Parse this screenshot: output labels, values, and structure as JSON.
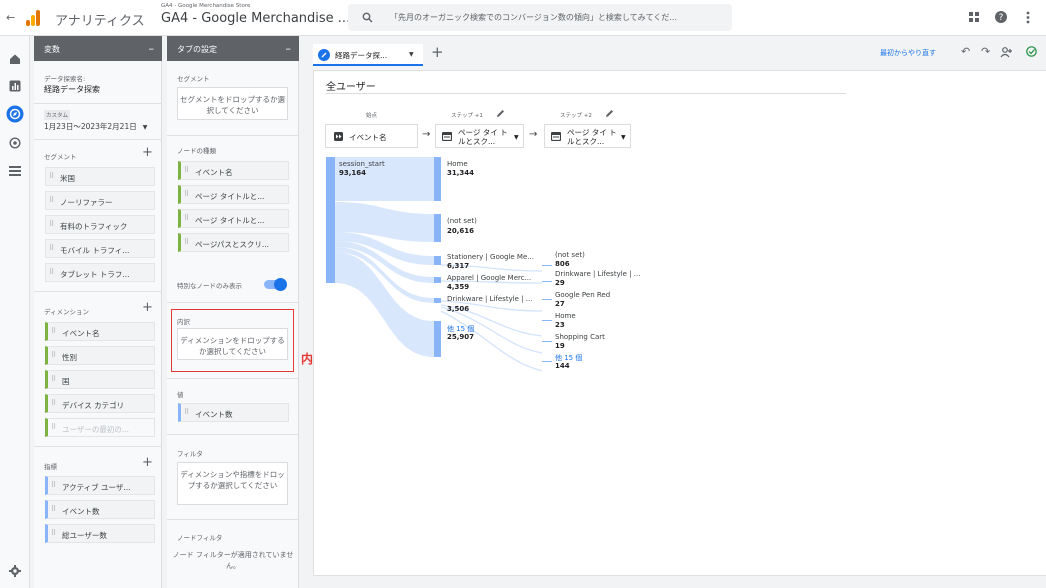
{
  "header": {
    "back": "←",
    "app_name": "アナリティクス",
    "account_path": "GA4 - Google Merchandise Store",
    "property": "GA4 - Google Merchandise ...",
    "search_placeholder": "「先月のオーガニック検索でのコンバージョン数の傾向」と検索してみてくだ..."
  },
  "variables": {
    "title": "変数",
    "name_label": "データ探索名:",
    "name_value": "経路データ探索",
    "custom_label": "カスタム",
    "date_range": "1月23日〜2023年2月21日",
    "segments_title": "セグメント",
    "segments": [
      "米国",
      "ノーリファラー",
      "有料のトラフィック",
      "モバイル トラフィ...",
      "タブレット トラフ..."
    ],
    "dimensions_title": "ディメンション",
    "dimensions": [
      "イベント名",
      "性別",
      "国",
      "デバイス カテゴリ",
      "ユーザーの最初の..."
    ],
    "metrics_title": "指標",
    "metrics": [
      "アクティブ ユーザ...",
      "イベント数",
      "総ユーザー数"
    ]
  },
  "settings": {
    "title": "タブの設定",
    "segment_label": "セグメント",
    "segment_drop": "セグメントをドロップするか選択してください",
    "node_type_label": "ノードの種類",
    "node_types": [
      "イベント名",
      "ページ タイトルと...",
      "ページ タイトルと...",
      "ページパスとスクリ..."
    ],
    "unique_nodes": "特別なノードのみ表示",
    "breakdown_label": "内訳",
    "breakdown_drop": "ディメンションをドロップするか選択してください",
    "value_label": "値",
    "value_chip": "イベント数",
    "filter_label": "フィルタ",
    "filter_drop": "ディメンションや指標をドロップするか選択してください",
    "node_filter_label": "ノードフィルタ",
    "node_filter_text": "ノード フィルターが適用されていません。"
  },
  "annotation": "内訳設定可能",
  "tab": {
    "name": "経路データ探...",
    "reset": "最初からやり直す"
  },
  "canvas": {
    "segment_title": "全ユーザー",
    "start_label": "始点",
    "start_select": "イベント名",
    "step1_label": "ステップ +1",
    "step1_select": "ページ タイ トルとスク...",
    "step2_label": "ステップ +2",
    "step2_select": "ページ タイ トルとスク..."
  },
  "chart_data": {
    "type": "sankey",
    "start": {
      "label": "session_start",
      "value": "93,164"
    },
    "step1": [
      {
        "label": "Home",
        "value": "31,344"
      },
      {
        "label": "(not set)",
        "value": "20,616"
      },
      {
        "label": "Stationery | Google Me...",
        "value": "6,317"
      },
      {
        "label": "Apparel | Google Merc...",
        "value": "4,359"
      },
      {
        "label": "Drinkware | Lifestyle | ...",
        "value": "3,506"
      },
      {
        "label": "他 15 個",
        "value": "25,907"
      }
    ],
    "step2": [
      {
        "label": "(not set)",
        "value": "806"
      },
      {
        "label": "Drinkware | Lifestyle | ...",
        "value": "29"
      },
      {
        "label": "Google Pen Red",
        "value": "27"
      },
      {
        "label": "Home",
        "value": "23"
      },
      {
        "label": "Shopping Cart",
        "value": "19"
      },
      {
        "label": "他 15 個",
        "value": "144"
      }
    ]
  }
}
